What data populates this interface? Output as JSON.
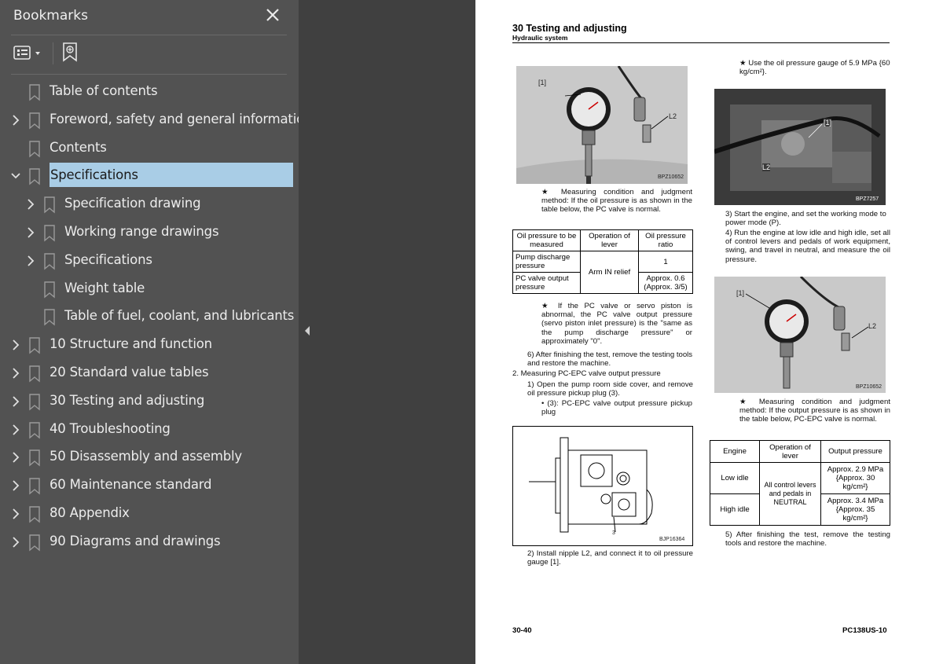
{
  "sidebar": {
    "title": "Bookmarks",
    "items": [
      {
        "label": "Table of contents",
        "level": 0,
        "expandable": false
      },
      {
        "label": "Foreword, safety and general information",
        "level": 0,
        "expandable": true
      },
      {
        "label": "Contents",
        "level": 0,
        "expandable": false
      },
      {
        "label": "Specifications",
        "level": 0,
        "expandable": true,
        "expanded": true,
        "selected": true
      },
      {
        "label": "Specification drawing",
        "level": 1,
        "expandable": true
      },
      {
        "label": "Working range drawings",
        "level": 1,
        "expandable": true
      },
      {
        "label": "Specifications",
        "level": 1,
        "expandable": true
      },
      {
        "label": "Weight table",
        "level": 1,
        "expandable": false
      },
      {
        "label": "Table of fuel, coolant, and lubricants",
        "level": 1,
        "expandable": false
      },
      {
        "label": "10 Structure and function",
        "level": 0,
        "expandable": true
      },
      {
        "label": "20 Standard value tables",
        "level": 0,
        "expandable": true
      },
      {
        "label": "30 Testing and adjusting",
        "level": 0,
        "expandable": true
      },
      {
        "label": "40 Troubleshooting",
        "level": 0,
        "expandable": true
      },
      {
        "label": "50 Disassembly and assembly",
        "level": 0,
        "expandable": true
      },
      {
        "label": "60 Maintenance standard",
        "level": 0,
        "expandable": true
      },
      {
        "label": "80 Appendix",
        "level": 0,
        "expandable": true
      },
      {
        "label": "90 Diagrams and drawings",
        "level": 0,
        "expandable": true
      }
    ]
  },
  "colors": {
    "sidebar_bg": "#525252",
    "selection": "#a9cde6",
    "viewer_bg": "#404040"
  },
  "page": {
    "title": "30 Testing and adjusting",
    "subtitle": "Hydraulic system",
    "left_col": {
      "photo1_code": "BPZ10652",
      "photo1_tag_gauge": "[1]",
      "photo1_tag_nipple": "L2",
      "note1": "★ Measuring condition and judgment method: If the oil pressure is as shown in the table below, the PC valve is normal.",
      "table1": {
        "headers": [
          "Oil pressure to be measured",
          "Operation of lever",
          "Oil pressure ratio"
        ],
        "row1_label": "Pump discharge pressure",
        "row1_value": "1",
        "row2_label": "PC valve output pressure",
        "row2_value": "Approx. 0.6 (Approx. 3/5)",
        "lever": "Arm IN relief"
      },
      "note2": "★ If the PC valve or servo piston is abnormal, the PC valve output pressure (servo piston inlet pressure) is the \"same as the pump discharge pressure\" or approximately \"0\".",
      "step6": "6) After finishing the test, remove the testing tools and restore the machine.",
      "item2": "2. Measuring PC-EPC valve output pressure",
      "step1": "1) Open the pump room side cover, and remove oil pressure pickup plug (3).",
      "bullet1": "• (3): PC-EPC valve output pressure pickup plug",
      "drawing_code": "BJP16364",
      "drawing_callout": "3",
      "step2": "2) Install nipple L2, and connect it to oil pressure gauge [1]."
    },
    "right_col": {
      "note_gauge": "★ Use the oil pressure gauge of 5.9 MPa {60 kg/cm²}.",
      "photo2_code": "BPZ7257",
      "photo2_tag_gauge": "[1]",
      "photo2_tag_nipple": "L2",
      "step3": "3) Start the engine, and set the working mode to power mode (P).",
      "step4": "4) Run the engine at low idle and high idle, set all of control levers and pedals of work equipment, swing, and travel in neutral, and measure the oil pressure.",
      "photo3_code": "BPZ10652",
      "photo3_tag_gauge": "[1]",
      "photo3_tag_nipple": "L2",
      "note3": "★ Measuring condition and judgment method: If the output pressure is as shown in the table below, PC-EPC valve is normal.",
      "table2": {
        "headers": [
          "Engine",
          "Operation of lever",
          "Output pressure"
        ],
        "row1_engine": "Low idle",
        "row1_value": "Approx. 2.9 MPa {Approx. 30 kg/cm²}",
        "row2_engine": "High idle",
        "row2_value": "Approx. 3.4 MPa {Approx. 35 kg/cm²}",
        "lever": "All control levers and pedals in NEUTRAL"
      },
      "step5": "5) After finishing the test, remove the testing tools and restore the machine."
    },
    "footer_left": "30-40",
    "footer_right": "PC138US-10"
  }
}
